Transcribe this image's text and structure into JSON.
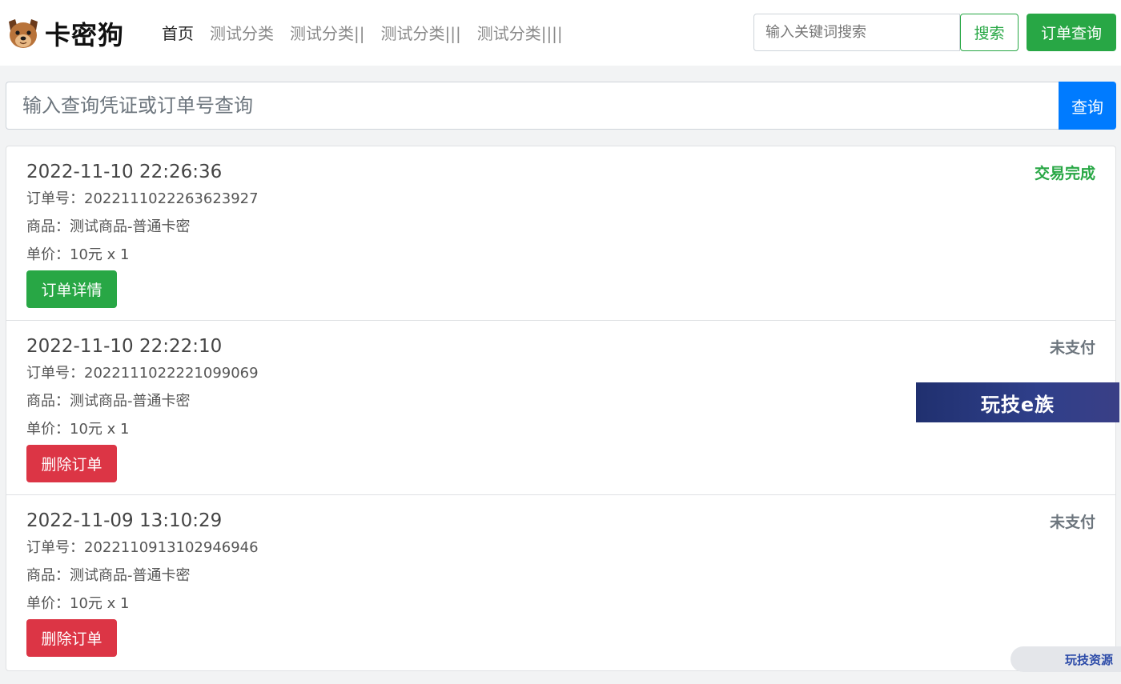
{
  "brand": {
    "name": "卡密狗"
  },
  "nav": {
    "items": [
      {
        "label": "首页",
        "active": true
      },
      {
        "label": "测试分类",
        "active": false
      },
      {
        "label": "测试分类||",
        "active": false
      },
      {
        "label": "测试分类|||",
        "active": false
      },
      {
        "label": "测试分类||||",
        "active": false
      }
    ]
  },
  "header": {
    "search_placeholder": "输入关键词搜索",
    "search_label": "搜索",
    "order_query_label": "订单查询"
  },
  "query": {
    "placeholder": "输入查询凭证或订单号查询",
    "button_label": "查询"
  },
  "orders": [
    {
      "time": "2022-11-10 22:26:36",
      "status": "交易完成",
      "order_no": "订单号：2022111022263623927",
      "product": "商品：测试商品-普通卡密",
      "price": "单价：10元 x 1",
      "action_label": "订单详情"
    },
    {
      "time": "2022-11-10 22:22:10",
      "status": "未支付",
      "order_no": "订单号：2022111022221099069",
      "product": "商品：测试商品-普通卡密",
      "price": "单价：10元 x 1",
      "action_label": "删除订单"
    },
    {
      "time": "2022-11-09 13:10:29",
      "status": "未支付",
      "order_no": "订单号：2022110913102946946",
      "product": "商品：测试商品-普通卡密",
      "price": "单价：10元 x 1",
      "action_label": "删除订单"
    }
  ],
  "watermarks": {
    "banner": "玩技e族",
    "pill": "玩技资源"
  },
  "colors": {
    "success": "#28a745",
    "danger": "#dc3545",
    "primary": "#007bff",
    "muted": "#6c757d"
  },
  "icons": {
    "brand_logo": "dog-face-icon"
  }
}
